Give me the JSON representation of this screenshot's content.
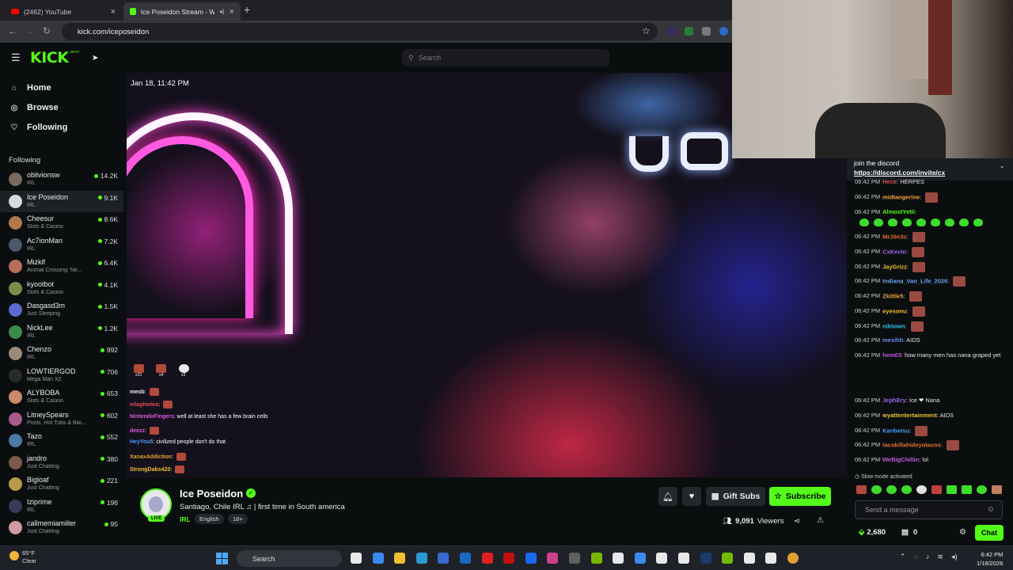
{
  "browser": {
    "tabs": [
      {
        "label": "(2462) YouTube"
      },
      {
        "label": "Ice Poseidon Stream - Watc"
      }
    ],
    "url": "kick.com/iceposeidon"
  },
  "kick": {
    "logo": "KICK",
    "beta": "BETA",
    "search_placeholder": "Search",
    "nav": [
      {
        "label": "Home",
        "icon": "home-icon"
      },
      {
        "label": "Browse",
        "icon": "compass-icon"
      },
      {
        "label": "Following",
        "icon": "heart-icon"
      }
    ],
    "following_header": "Following",
    "channels": [
      {
        "name": "oblivionsw",
        "category": "IRL",
        "viewers": "14.2K",
        "color": "#7a6a5e"
      },
      {
        "name": "Ice Poseidon",
        "category": "IRL",
        "viewers": "9.1K",
        "color": "#d8d8e0"
      },
      {
        "name": "Cheesur",
        "category": "Slots & Casino",
        "viewers": "8.6K",
        "color": "#b3774d"
      },
      {
        "name": "Ac7ionMan",
        "category": "IRL",
        "viewers": "7.2K",
        "color": "#4a5a6a"
      },
      {
        "name": "Mizkif",
        "category": "Animal Crossing: Ne...",
        "viewers": "6.4K",
        "color": "#b86d58"
      },
      {
        "name": "kyootbot",
        "category": "Slots & Casino",
        "viewers": "4.1K",
        "color": "#7a8c4a"
      },
      {
        "name": "Dasgasd3m",
        "category": "Just Sleeping",
        "viewers": "1.5K",
        "color": "#5a6ad0"
      },
      {
        "name": "NickLee",
        "category": "IRL",
        "viewers": "1.2K",
        "color": "#3a8a4a"
      },
      {
        "name": "Chenzo",
        "category": "IRL",
        "viewers": "992",
        "color": "#9a8a7a"
      },
      {
        "name": "LOWTIERGOD",
        "category": "Mega Man X2",
        "viewers": "706",
        "color": "#2a2a2a"
      },
      {
        "name": "ALYBOBA",
        "category": "Slots & Casino",
        "viewers": "653",
        "color": "#c88a6a"
      },
      {
        "name": "LitneySpears",
        "category": "Pools, Hot Tubs & Biki...",
        "viewers": "602",
        "color": "#a85a8a"
      },
      {
        "name": "Tazo",
        "category": "IRL",
        "viewers": "552",
        "color": "#4a7aa8"
      },
      {
        "name": "jandro",
        "category": "Just Chatting",
        "viewers": "380",
        "color": "#7a5a4a"
      },
      {
        "name": "Bigloaf",
        "category": "Just Chatting",
        "viewers": "221",
        "color": "#b89a4a"
      },
      {
        "name": "Iziprime",
        "category": "IRL",
        "viewers": "196",
        "color": "#3a3a5a"
      },
      {
        "name": "callmemiamiller",
        "category": "Just Chatting",
        "viewers": "95",
        "color": "#d09aa0"
      }
    ]
  },
  "video": {
    "timestamp": "Jan 18, 11:42 PM",
    "emote_counts": [
      "x23",
      "x4",
      "x3"
    ],
    "overlay_chat": [
      {
        "user": "meob",
        "text": "",
        "color": "#e8e8e8",
        "emote": true
      },
      {
        "user": "mlaghmlea",
        "text": "",
        "color": "#e05050",
        "emote": true
      },
      {
        "user": "NintendoFingers",
        "text": "well at least she has a few brain cells",
        "color": "#d85ad8",
        "emote": false
      },
      {
        "user": "deezz",
        "text": "",
        "color": "#d85ad8",
        "emote": true
      },
      {
        "user": "HeyYou5",
        "text": "civilized people don't do that",
        "color": "#4a9af5",
        "emote": false
      },
      {
        "user": "XanaxAddiction",
        "text": "",
        "color": "#e0a030",
        "emote": true
      },
      {
        "user": "StrongDabs420",
        "text": "",
        "color": "#f0c030",
        "emote": true
      }
    ]
  },
  "stream": {
    "name": "Ice Poseidon",
    "title": "Santiago, Chile IRL ♫ | first time in South america",
    "category": "IRL",
    "tags": [
      "English",
      "18+"
    ],
    "live": "LIVE",
    "gift_label": "Gift Subs",
    "subscribe_label": "Subscribe",
    "viewers": "9,091",
    "viewers_label": "Viewers"
  },
  "chat": {
    "pinned_line1": "join the discord",
    "pinned_link": "https://discord.com/invite/cx",
    "messages": [
      {
        "ts": "06:42 PM",
        "user": "Hece",
        "text": "HERPES",
        "color": "#e05050",
        "emote": false
      },
      {
        "ts": "06:42 PM",
        "user": "midtangerine",
        "text": "",
        "color": "#f0a040",
        "emote": true
      },
      {
        "ts": "06:42 PM",
        "user": "AlmostYetii",
        "text": "",
        "color": "#53fc18",
        "emote": false
      },
      {
        "ts": "06:42 PM",
        "user": "MrJ0n3s",
        "text": "",
        "color": "#e07030",
        "emote": true
      },
      {
        "ts": "06:42 PM",
        "user": "CxKevin",
        "text": "",
        "color": "#a06af0",
        "emote": true
      },
      {
        "ts": "06:42 PM",
        "user": "JayGrizz",
        "text": "",
        "color": "#f0c030",
        "emote": true
      },
      {
        "ts": "06:42 PM",
        "user": "Indiana_Van_Life_2026",
        "text": "",
        "color": "#6aa0f0",
        "emote": true
      },
      {
        "ts": "06:42 PM",
        "user": "Zkittle5",
        "text": "",
        "color": "#f0a040",
        "emote": true
      },
      {
        "ts": "06:42 PM",
        "user": "eyesonu",
        "text": "",
        "color": "#f0c030",
        "emote": true
      },
      {
        "ts": "06:42 PM",
        "user": "niktown",
        "text": "",
        "color": "#30c0e0",
        "emote": true
      },
      {
        "ts": "06:42 PM",
        "user": "mexihh",
        "text": "AIDS",
        "color": "#6a8af0",
        "emote": false
      },
      {
        "ts": "06:42 PM",
        "user": "hem03",
        "text": "how many men has nana graped yet",
        "color": "#c05ad8",
        "emote": false
      },
      {
        "ts": "06:42 PM",
        "user": "JephEry",
        "text": "Ice ❤ Nana",
        "color": "#9a6af0",
        "emote": false
      },
      {
        "ts": "06:42 PM",
        "user": "wyattentertainment",
        "text": "AIDS",
        "color": "#f0c030",
        "emote": false
      },
      {
        "ts": "06:42 PM",
        "user": "Kanbetsu",
        "text": "",
        "color": "#4a9af5",
        "emote": true
      },
      {
        "ts": "06:42 PM",
        "user": "tacokillahideyotacos",
        "text": "",
        "color": "#e07030",
        "emote": true
      },
      {
        "ts": "06:42 PM",
        "user": "WeBigChillin",
        "text": "lol",
        "color": "#c05ad8",
        "emote": false
      }
    ],
    "slow_mode": "Slow mode activated",
    "input_placeholder": "Send a message",
    "points": "2,680",
    "gift_count": "0",
    "chat_button": "Chat"
  },
  "taskbar": {
    "temp": "65°F",
    "weather": "Clear",
    "search": "Search",
    "time": "6:42 PM",
    "date": "1/18/2026"
  }
}
